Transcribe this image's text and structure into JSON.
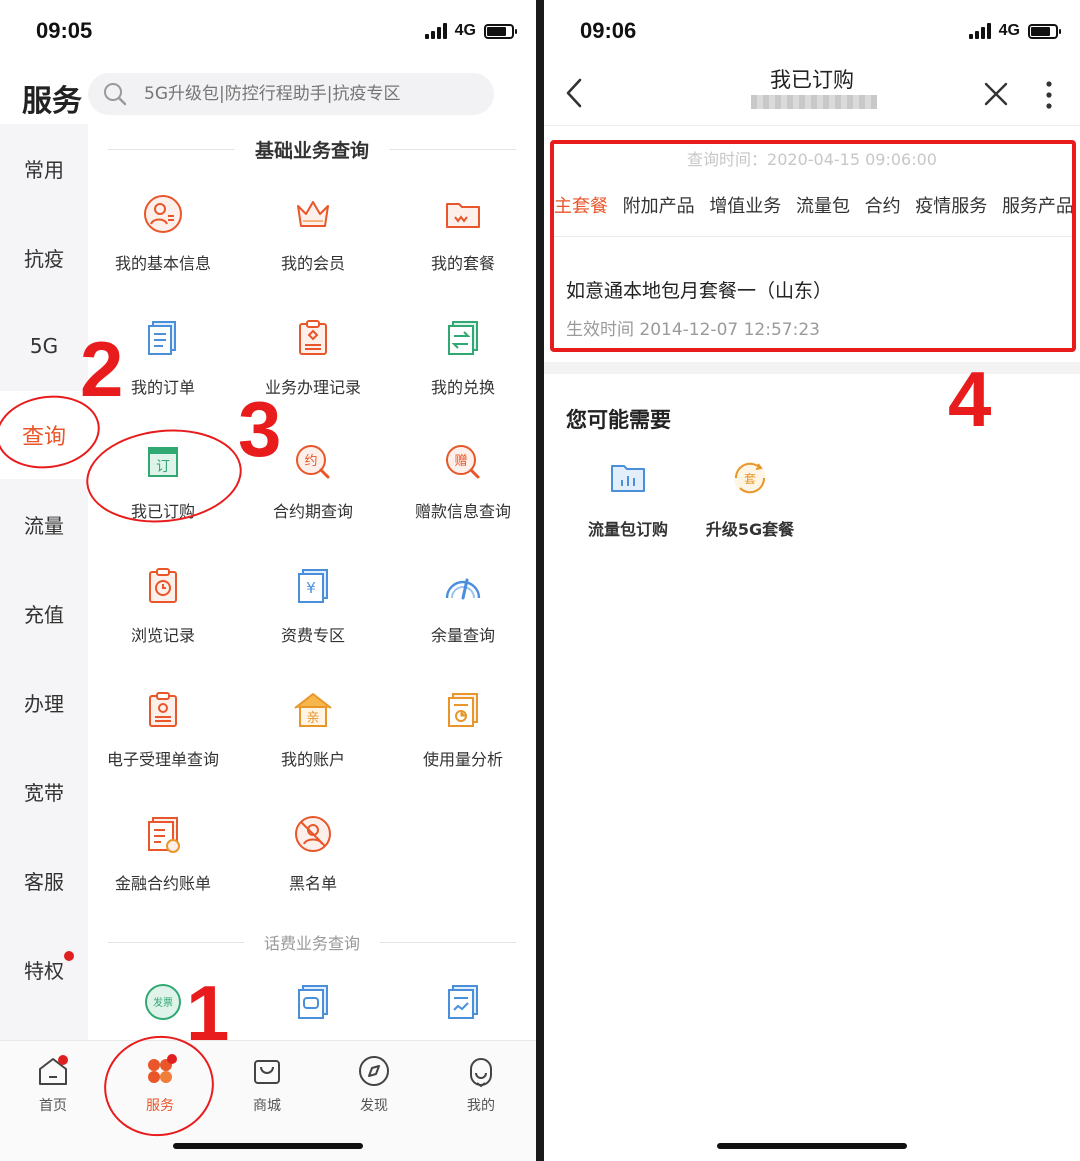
{
  "left": {
    "status": {
      "time": "09:05",
      "network": "4G"
    },
    "header": {
      "title": "服务",
      "search_placeholder": "5G升级包|防控行程助手|抗疫专区"
    },
    "sidebar": [
      "常用",
      "抗疫",
      "5G",
      "查询",
      "流量",
      "充值",
      "办理",
      "宽带",
      "客服",
      "特权"
    ],
    "sidebar_active": "查询",
    "sections": {
      "basic": "基础业务查询",
      "billing": "话费业务查询"
    },
    "grid": [
      "我的基本信息",
      "我的会员",
      "我的套餐",
      "我的订单",
      "业务办理记录",
      "我的兑换",
      "我已订购",
      "合约期查询",
      "赠款信息查询",
      "浏览记录",
      "资费专区",
      "余量查询",
      "电子受理单查询",
      "我的账户",
      "使用量分析",
      "金融合约账单",
      "黑名单"
    ],
    "icon_glyphs": {
      "ding": "订",
      "yue": "约",
      "zeng": "赠",
      "yen": "¥",
      "qin": "亲",
      "fapiao": "发票"
    },
    "tabbar": [
      "首页",
      "服务",
      "商城",
      "发现",
      "我的"
    ],
    "annotations": [
      "1",
      "2",
      "3"
    ]
  },
  "right": {
    "status": {
      "time": "09:06",
      "network": "4G"
    },
    "nav": {
      "title": "我已订购"
    },
    "query_time": "查询时间：2020-04-15 09:06:00",
    "tabs": [
      "主套餐",
      "附加产品",
      "增值业务",
      "流量包",
      "合约",
      "疫情服务",
      "服务产品"
    ],
    "package": {
      "name": "如意通本地包月套餐一（山东）",
      "effective": "生效时间 2014-12-07 12:57:23"
    },
    "need": {
      "title": "您可能需要",
      "items": [
        "流量包订购",
        "升级5G套餐"
      ],
      "badge": "套"
    },
    "annotation": "4"
  },
  "colors": {
    "accent": "#e8562a",
    "annotation": "#e81c1c"
  }
}
